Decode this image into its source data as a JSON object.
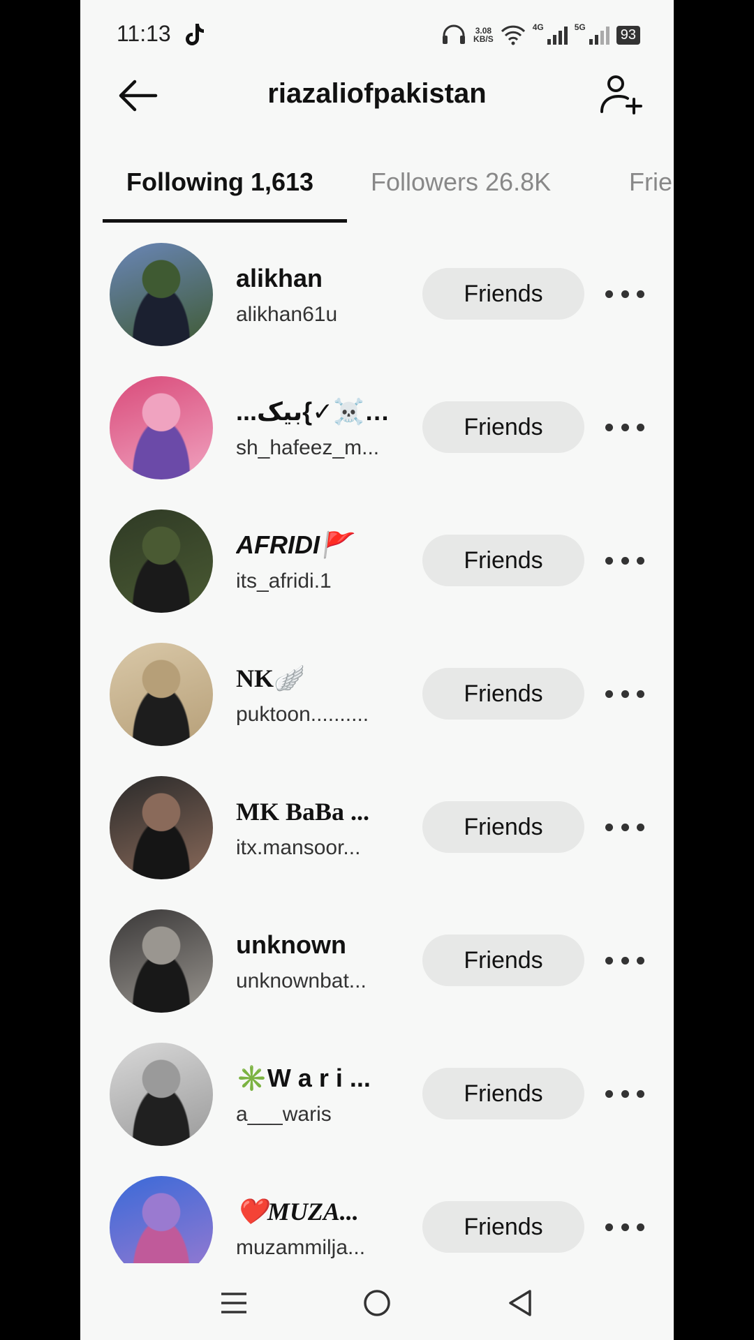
{
  "status_bar": {
    "time": "11:13",
    "net_speed_value": "3.08",
    "net_speed_unit": "KB/S",
    "signal_1_label": "4G",
    "signal_2_label": "5G",
    "battery": "93"
  },
  "header": {
    "title": "riazaliofpakistan"
  },
  "tabs": [
    {
      "label": "Following 1,613",
      "active": true
    },
    {
      "label": "Followers 26.8K",
      "active": false
    },
    {
      "label": "Frie",
      "active": false
    }
  ],
  "users": [
    {
      "name": "alikhan",
      "handle": "alikhan61u",
      "button": "Friends",
      "avatar_colors": [
        "#6a86b8",
        "#3f5a32",
        "#1b2030"
      ]
    },
    {
      "name": "...بیک{✓☠️🥷",
      "handle": "sh_hafeez_m...",
      "button": "Friends",
      "avatar_colors": [
        "#d94b7a",
        "#f0a3c0",
        "#6b4aa8"
      ]
    },
    {
      "name": "AFRIDI🚩",
      "handle": "its_afridi.1",
      "button": "Friends",
      "avatar_colors": [
        "#2f3a25",
        "#4a5a33",
        "#1a1a1a"
      ]
    },
    {
      "name": "NK🪽",
      "handle": "puktoon..........",
      "button": "Friends",
      "avatar_colors": [
        "#d9c8a8",
        "#b69f78",
        "#1d1d1d"
      ]
    },
    {
      "name": "MK BaBa ...",
      "handle": "itx.mansoor...",
      "button": "Friends",
      "avatar_colors": [
        "#2a2a2a",
        "#8a6a5a",
        "#151515"
      ]
    },
    {
      "name": "unknown",
      "handle": "unknownbat...",
      "button": "Friends",
      "avatar_colors": [
        "#3a3838",
        "#9a9690",
        "#181818"
      ]
    },
    {
      "name": "✳️W a r i ...",
      "handle": "a___waris",
      "button": "Friends",
      "avatar_colors": [
        "#d8d8d8",
        "#9a9a9a",
        "#202020"
      ]
    },
    {
      "name": "❤️MUZA...",
      "handle": "muzammilja...",
      "button": "Friends",
      "avatar_colors": [
        "#3a6ad8",
        "#9a7ad0",
        "#c05a9a"
      ]
    }
  ],
  "colors": {
    "background": "#f7f8f7",
    "button_bg": "#e7e8e7",
    "text_primary": "#111111",
    "text_inactive": "#888888"
  },
  "icons": {
    "back": "arrow-left-icon",
    "add_user": "person-plus-icon",
    "more": "more-horizontal-icon",
    "nav_menu": "hamburger-icon",
    "nav_home": "circle-icon",
    "nav_back": "triangle-back-icon"
  }
}
